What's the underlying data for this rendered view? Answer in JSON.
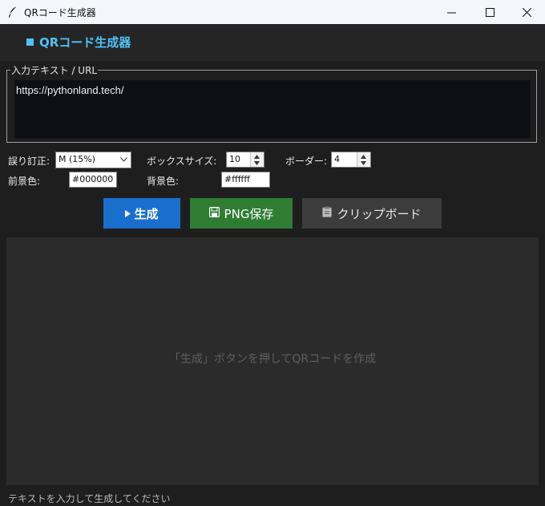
{
  "window": {
    "title": "QRコード生成器"
  },
  "header": {
    "title": "QRコード生成器"
  },
  "input": {
    "legend": "入力テキスト / URL",
    "value": "https://pythonland.tech/"
  },
  "settings": {
    "error_correction_label": "誤り訂正:",
    "error_correction_value": "M (15%)",
    "box_size_label": "ボックスサイズ:",
    "box_size_value": "10",
    "border_label": "ボーダー:",
    "border_value": "4",
    "foreground_label": "前景色:",
    "foreground_value": "#000000",
    "background_label": "背景色:",
    "background_value": "#ffffff"
  },
  "buttons": {
    "generate": "生成",
    "save_png": "PNG保存",
    "clipboard": "クリップボード"
  },
  "preview": {
    "hint": "「生成」ボタンを押してQRコードを作成"
  },
  "status": {
    "text": "テキストを入力して生成してください"
  },
  "colors": {
    "accent": "#4fc3f7",
    "generate": "#1a6fce",
    "save": "#2e7d32",
    "clipboard": "#3c3c3c"
  }
}
